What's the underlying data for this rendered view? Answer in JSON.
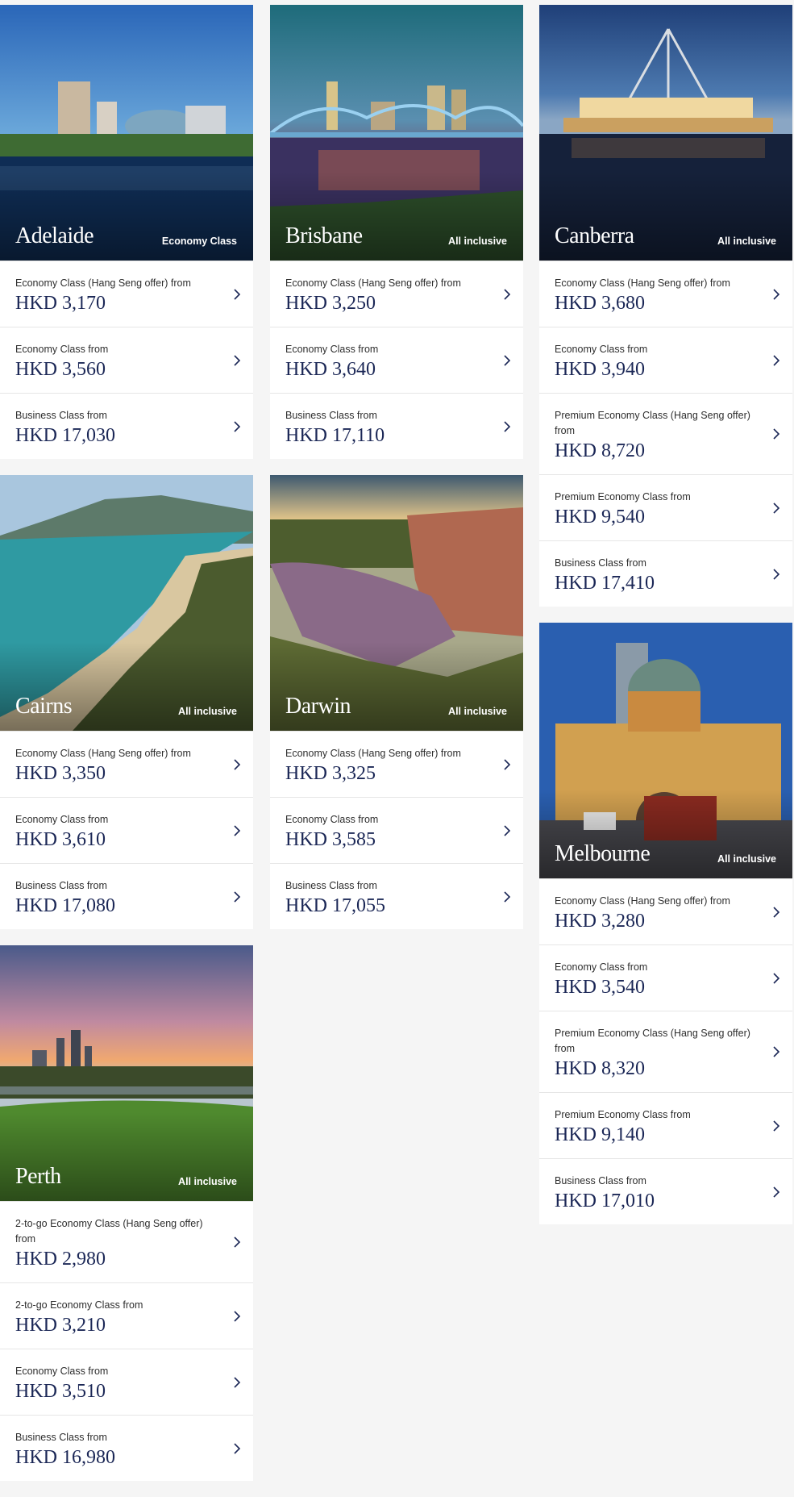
{
  "destinations": [
    {
      "city": "Adelaide",
      "class": "Economy Class",
      "fares": [
        {
          "label": "Economy Class (Hang Seng offer) from",
          "price": "HKD 3,170"
        },
        {
          "label": "Economy Class from",
          "price": "HKD 3,560"
        },
        {
          "label": "Business Class from",
          "price": "HKD 17,030"
        }
      ]
    },
    {
      "city": "Brisbane",
      "class": "All inclusive",
      "fares": [
        {
          "label": "Economy Class (Hang Seng offer) from",
          "price": "HKD 3,250"
        },
        {
          "label": "Economy Class from",
          "price": "HKD 3,640"
        },
        {
          "label": "Business Class from",
          "price": "HKD 17,110"
        }
      ]
    },
    {
      "city": "Canberra",
      "class": "All inclusive",
      "fares": [
        {
          "label": "Economy Class (Hang Seng offer) from",
          "price": "HKD 3,680"
        },
        {
          "label": "Economy Class from",
          "price": "HKD 3,940"
        },
        {
          "label": "Premium Economy Class (Hang Seng offer) from",
          "price": "HKD 8,720"
        },
        {
          "label": "Premium Economy Class from",
          "price": "HKD 9,540"
        },
        {
          "label": "Business Class from",
          "price": "HKD 17,410"
        }
      ]
    },
    {
      "city": "Cairns",
      "class": "All inclusive",
      "fares": [
        {
          "label": "Economy Class (Hang Seng offer) from",
          "price": "HKD 3,350"
        },
        {
          "label": "Economy Class from",
          "price": "HKD 3,610"
        },
        {
          "label": "Business Class from",
          "price": "HKD 17,080"
        }
      ]
    },
    {
      "city": "Darwin",
      "class": "All inclusive",
      "fares": [
        {
          "label": "Economy Class (Hang Seng offer) from",
          "price": "HKD 3,325"
        },
        {
          "label": "Economy Class from",
          "price": "HKD 3,585"
        },
        {
          "label": "Business Class from",
          "price": "HKD 17,055"
        }
      ]
    },
    {
      "city": "Melbourne",
      "class": "All inclusive",
      "fares": [
        {
          "label": "Economy Class (Hang Seng offer) from",
          "price": "HKD 3,280"
        },
        {
          "label": "Economy Class from",
          "price": "HKD 3,540"
        },
        {
          "label": "Premium Economy Class (Hang Seng offer) from",
          "price": "HKD 8,320"
        },
        {
          "label": "Premium Economy Class from",
          "price": "HKD 9,140"
        },
        {
          "label": "Business Class from",
          "price": "HKD 17,010"
        }
      ]
    },
    {
      "city": "Perth",
      "class": "All inclusive",
      "fares": [
        {
          "label": "2-to-go Economy Class (Hang Seng offer) from",
          "price": "HKD 2,980"
        },
        {
          "label": "2-to-go Economy Class from",
          "price": "HKD 3,210"
        },
        {
          "label": "Economy Class from",
          "price": "HKD 3,510"
        },
        {
          "label": "Business Class from",
          "price": "HKD 16,980"
        }
      ]
    }
  ],
  "colors": {
    "price": "#1b2756",
    "label": "#2e2e2e",
    "chevron": "#1b2756",
    "page_bg": "#f5f5f5"
  },
  "icons": {
    "row_arrow": "chevron-right-icon"
  }
}
